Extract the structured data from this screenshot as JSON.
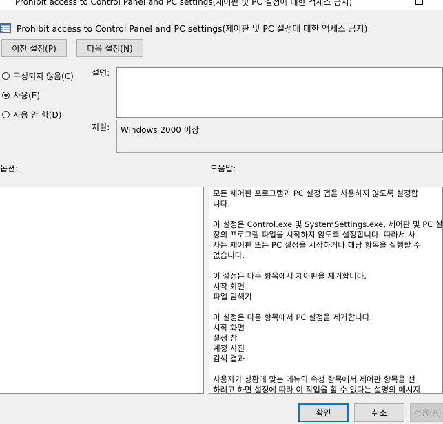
{
  "window": {
    "title": "Prohibit access to Control Panel and PC settings(제어판 및 PC 설정에 대한 액세스 금지)"
  },
  "header": {
    "title": "Prohibit access to Control Panel and PC settings(제어판 및 PC 설정에 대한 액세스 금지)",
    "icon": "policy-settings-icon"
  },
  "nav": {
    "prev_label": "이전 설정(P)",
    "next_label": "다음 설정(N)"
  },
  "state_options": [
    {
      "label": "구성되지 않음(C)",
      "checked": false
    },
    {
      "label": "사용(E)",
      "checked": true
    },
    {
      "label": "사용 안 함(D)",
      "checked": false
    }
  ],
  "comment": {
    "label": "설명:",
    "value": ""
  },
  "supported": {
    "label": "지원:",
    "value": "Windows 2000 이상"
  },
  "options_label": "옵션:",
  "help_label": "도움말:",
  "help_paragraphs": [
    "모든 제어판 프로그램과 PC 설정 앱을 사용하지 않도록 설정합\n니다.",
    "이 설정은 Control.exe 및 SystemSettings.exe, 제어판 및 PC 설\n정의 프로그램 파일을 시작하지 않도록 설정합니다. 따라서 사\n자는 제어판 또는 PC 설정을 시작하거나 해당 항목을 실행할 수\n없습니다.",
    "이 설정은 다음 항목에서 제어판을 제거합니다.\n시작 화면\n파일 탐색기",
    "이 설정은 다음 항목에서 PC 설정을 제거합니다.\n시작 화면\n설정 참\n계정 사진\n검색 결과",
    "사용자가 상황에 맞는 메뉴의 속성 항목에서 제어판 항목을 선\n하려고 하면 설정에 따라 이 작업을 할 수 없다는 설명의 메시지"
  ],
  "footer": {
    "ok_label": "확인",
    "cancel_label": "취소",
    "apply_label": "적용(A)"
  }
}
